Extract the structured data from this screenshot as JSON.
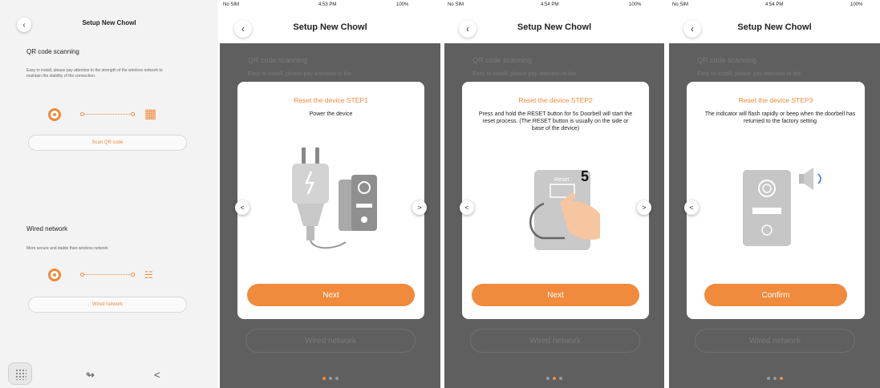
{
  "colors": {
    "accent": "#f08a3c",
    "overlay": "#5f5f5f"
  },
  "main": {
    "title": "Setup New Chowl",
    "qr_section": {
      "title": "QR code scanning",
      "desc": "Easy to install, please pay attention to the strength of the wireless network to maintain the stability of the connection.",
      "button": "Scan QR code"
    },
    "wired_section": {
      "title": "Wired network",
      "desc": "More secure and stable than wireless network",
      "button": "Wired network"
    }
  },
  "phones": [
    {
      "status": {
        "carrier": "No SIM",
        "time": "4:53 PM",
        "battery": "100%"
      },
      "title": "Setup New Chowl",
      "bg": {
        "qr_title": "QR code scanning",
        "desc": "Easy to install, please pay attention to the",
        "wired_button": "Wired network"
      },
      "modal": {
        "step": "Reset the device STEP1",
        "instruction": "Power the device",
        "button": "Next"
      }
    },
    {
      "status": {
        "carrier": "No SIM",
        "time": "4:54 PM",
        "battery": "100%"
      },
      "title": "Setup New Chowl",
      "bg": {
        "qr_title": "QR code scanning",
        "desc": "Easy to install, please pay attention to the",
        "wired_button": "Wired network"
      },
      "modal": {
        "step": "Reset the device STEP2",
        "instruction": "Press and hold the RESET button for 5s Doorbell will start the reset process. (The RESET button is usually on the side or base of the device)",
        "countdown": "5",
        "reset_label": "Reset",
        "button": "Next"
      }
    },
    {
      "status": {
        "carrier": "No SIM",
        "time": "4:54 PM",
        "battery": "100%"
      },
      "title": "Setup New Chowl",
      "bg": {
        "qr_title": "QR code scanning",
        "desc": "Easy to install, please pay attention to the",
        "wired_button": "Wired network"
      },
      "modal": {
        "step": "Reset the device STEP3",
        "instruction": "The indicator will flash rapidly or beep when the doorbell has returned to the factory setting",
        "button": "Confirm"
      }
    }
  ],
  "pager": {
    "pages": 3
  },
  "icons": [
    "back-icon",
    "doorbell-icon",
    "qr-code-icon",
    "router-icon",
    "home-grid-icon",
    "share-icon",
    "chevron-left-icon",
    "chevron-right-icon",
    "plug-icon",
    "speaker-icon",
    "hand-icon"
  ]
}
